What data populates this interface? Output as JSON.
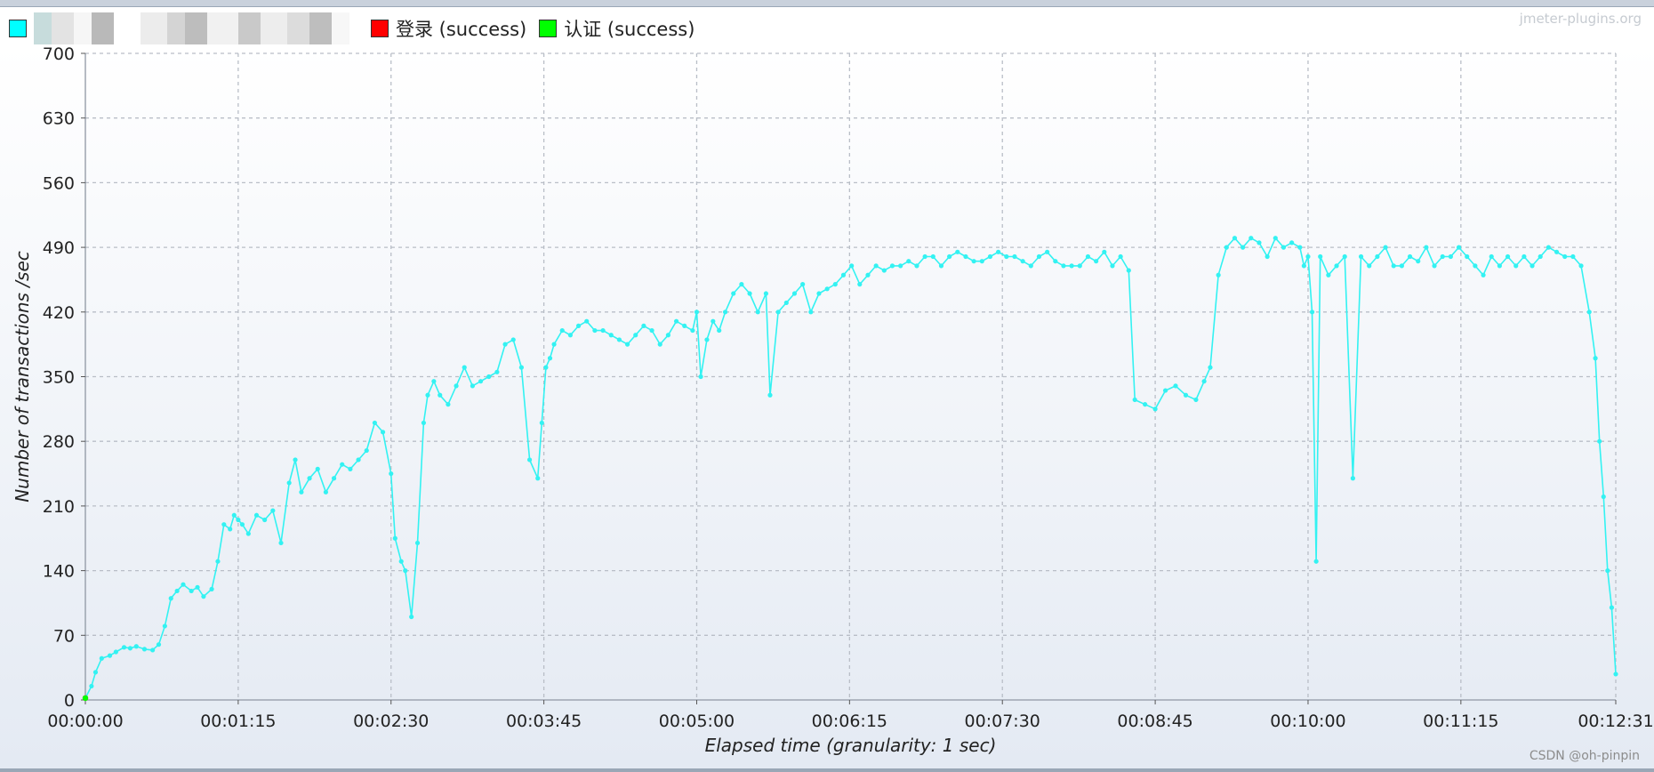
{
  "watermark": "jmeter-plugins.org",
  "footer_credit": "CSDN @oh-pinpin",
  "legend": [
    {
      "label": "",
      "color": "#00ffff",
      "redacted": true
    },
    {
      "label": "登录 (success)",
      "color": "#ff0000"
    },
    {
      "label": "认证 (success)",
      "color": "#00ff00"
    }
  ],
  "colors": {
    "series": "#33f2f2",
    "grid": "#b9bec7",
    "plot_bg_top": "#ffffff",
    "plot_bg_bottom": "#e4eaf3"
  },
  "chart_data": {
    "type": "line",
    "xlabel": "Elapsed time (granularity: 1 sec)",
    "ylabel": "Number of transactions /sec",
    "x_unit": "seconds",
    "xlim": [
      0,
      751
    ],
    "ylim": [
      0,
      700
    ],
    "y_ticks": [
      0,
      70,
      140,
      210,
      280,
      350,
      420,
      490,
      560,
      630,
      700
    ],
    "x_ticks": [
      {
        "value": 0,
        "label": "00:00:00"
      },
      {
        "value": 75,
        "label": "00:01:15"
      },
      {
        "value": 150,
        "label": "00:02:30"
      },
      {
        "value": 225,
        "label": "00:03:45"
      },
      {
        "value": 300,
        "label": "00:05:00"
      },
      {
        "value": 375,
        "label": "00:06:15"
      },
      {
        "value": 450,
        "label": "00:07:30"
      },
      {
        "value": 525,
        "label": "00:08:45"
      },
      {
        "value": 600,
        "label": "00:10:00"
      },
      {
        "value": 675,
        "label": "00:11:15"
      },
      {
        "value": 751,
        "label": "00:12:31"
      }
    ],
    "grid": true,
    "series": [
      {
        "name": "",
        "color": "#33f2f2",
        "x": [
          0,
          3,
          5,
          8,
          12,
          15,
          19,
          22,
          25,
          29,
          33,
          36,
          39,
          42,
          45,
          48,
          52,
          55,
          58,
          62,
          65,
          68,
          71,
          73,
          75,
          77,
          80,
          84,
          88,
          92,
          96,
          100,
          103,
          106,
          110,
          114,
          118,
          122,
          126,
          130,
          134,
          138,
          142,
          146,
          150,
          152,
          155,
          157,
          160,
          163,
          166,
          168,
          171,
          174,
          178,
          182,
          186,
          190,
          194,
          198,
          202,
          206,
          210,
          214,
          218,
          222,
          224,
          226,
          228,
          230,
          234,
          238,
          242,
          246,
          250,
          254,
          258,
          262,
          266,
          270,
          274,
          278,
          282,
          286,
          290,
          294,
          298,
          300,
          302,
          305,
          308,
          311,
          314,
          318,
          322,
          326,
          330,
          334,
          336,
          340,
          344,
          348,
          352,
          356,
          360,
          364,
          368,
          372,
          376,
          380,
          384,
          388,
          392,
          396,
          400,
          404,
          408,
          412,
          416,
          420,
          424,
          428,
          432,
          436,
          440,
          444,
          448,
          452,
          456,
          460,
          464,
          468,
          472,
          476,
          480,
          484,
          488,
          492,
          496,
          500,
          504,
          508,
          512,
          515,
          520,
          525,
          530,
          535,
          540,
          545,
          549,
          552,
          556,
          560,
          564,
          568,
          572,
          576,
          580,
          584,
          588,
          592,
          596,
          598,
          600,
          602,
          604,
          606,
          610,
          614,
          618,
          622,
          626,
          630,
          634,
          638,
          642,
          646,
          650,
          654,
          658,
          662,
          666,
          670,
          674,
          678,
          682,
          686,
          690,
          694,
          698,
          702,
          706,
          710,
          714,
          718,
          722,
          726,
          730,
          734,
          738,
          741,
          743,
          745,
          747,
          749,
          751
        ],
        "values": [
          2,
          15,
          30,
          45,
          48,
          52,
          57,
          56,
          58,
          55,
          54,
          60,
          80,
          110,
          118,
          125,
          118,
          122,
          112,
          120,
          150,
          190,
          185,
          200,
          195,
          190,
          180,
          200,
          195,
          205,
          170,
          235,
          260,
          225,
          240,
          250,
          225,
          240,
          255,
          250,
          260,
          270,
          300,
          290,
          245,
          175,
          150,
          140,
          90,
          170,
          300,
          330,
          345,
          330,
          320,
          340,
          360,
          340,
          345,
          350,
          355,
          385,
          390,
          360,
          260,
          240,
          300,
          360,
          370,
          385,
          400,
          395,
          405,
          410,
          400,
          400,
          395,
          390,
          385,
          395,
          405,
          400,
          385,
          395,
          410,
          405,
          400,
          420,
          350,
          390,
          410,
          400,
          420,
          440,
          450,
          440,
          420,
          440,
          330,
          420,
          430,
          440,
          450,
          420,
          440,
          445,
          450,
          460,
          470,
          450,
          460,
          470,
          465,
          470,
          470,
          475,
          470,
          480,
          480,
          470,
          480,
          485,
          480,
          475,
          475,
          480,
          485,
          480,
          480,
          475,
          470,
          480,
          485,
          475,
          470,
          470,
          470,
          480,
          475,
          485,
          470,
          480,
          465,
          325,
          320,
          315,
          335,
          340,
          330,
          325,
          345,
          360,
          460,
          490,
          500,
          490,
          500,
          495,
          480,
          500,
          490,
          495,
          490,
          470,
          480,
          420,
          150,
          480,
          460,
          470,
          480,
          240,
          480,
          470,
          480,
          490,
          470,
          470,
          480,
          475,
          490,
          470,
          480,
          480,
          490,
          480,
          470,
          460,
          480,
          470,
          480,
          470,
          480,
          470,
          480,
          490,
          485,
          480,
          480,
          470,
          420,
          370,
          280,
          220,
          140,
          100,
          28
        ]
      },
      {
        "name": "登录 (success)",
        "color": "#ff0000",
        "x": [
          0
        ],
        "values": [
          2
        ]
      },
      {
        "name": "认证 (success)",
        "color": "#00ff00",
        "x": [
          0
        ],
        "values": [
          2
        ]
      }
    ]
  }
}
